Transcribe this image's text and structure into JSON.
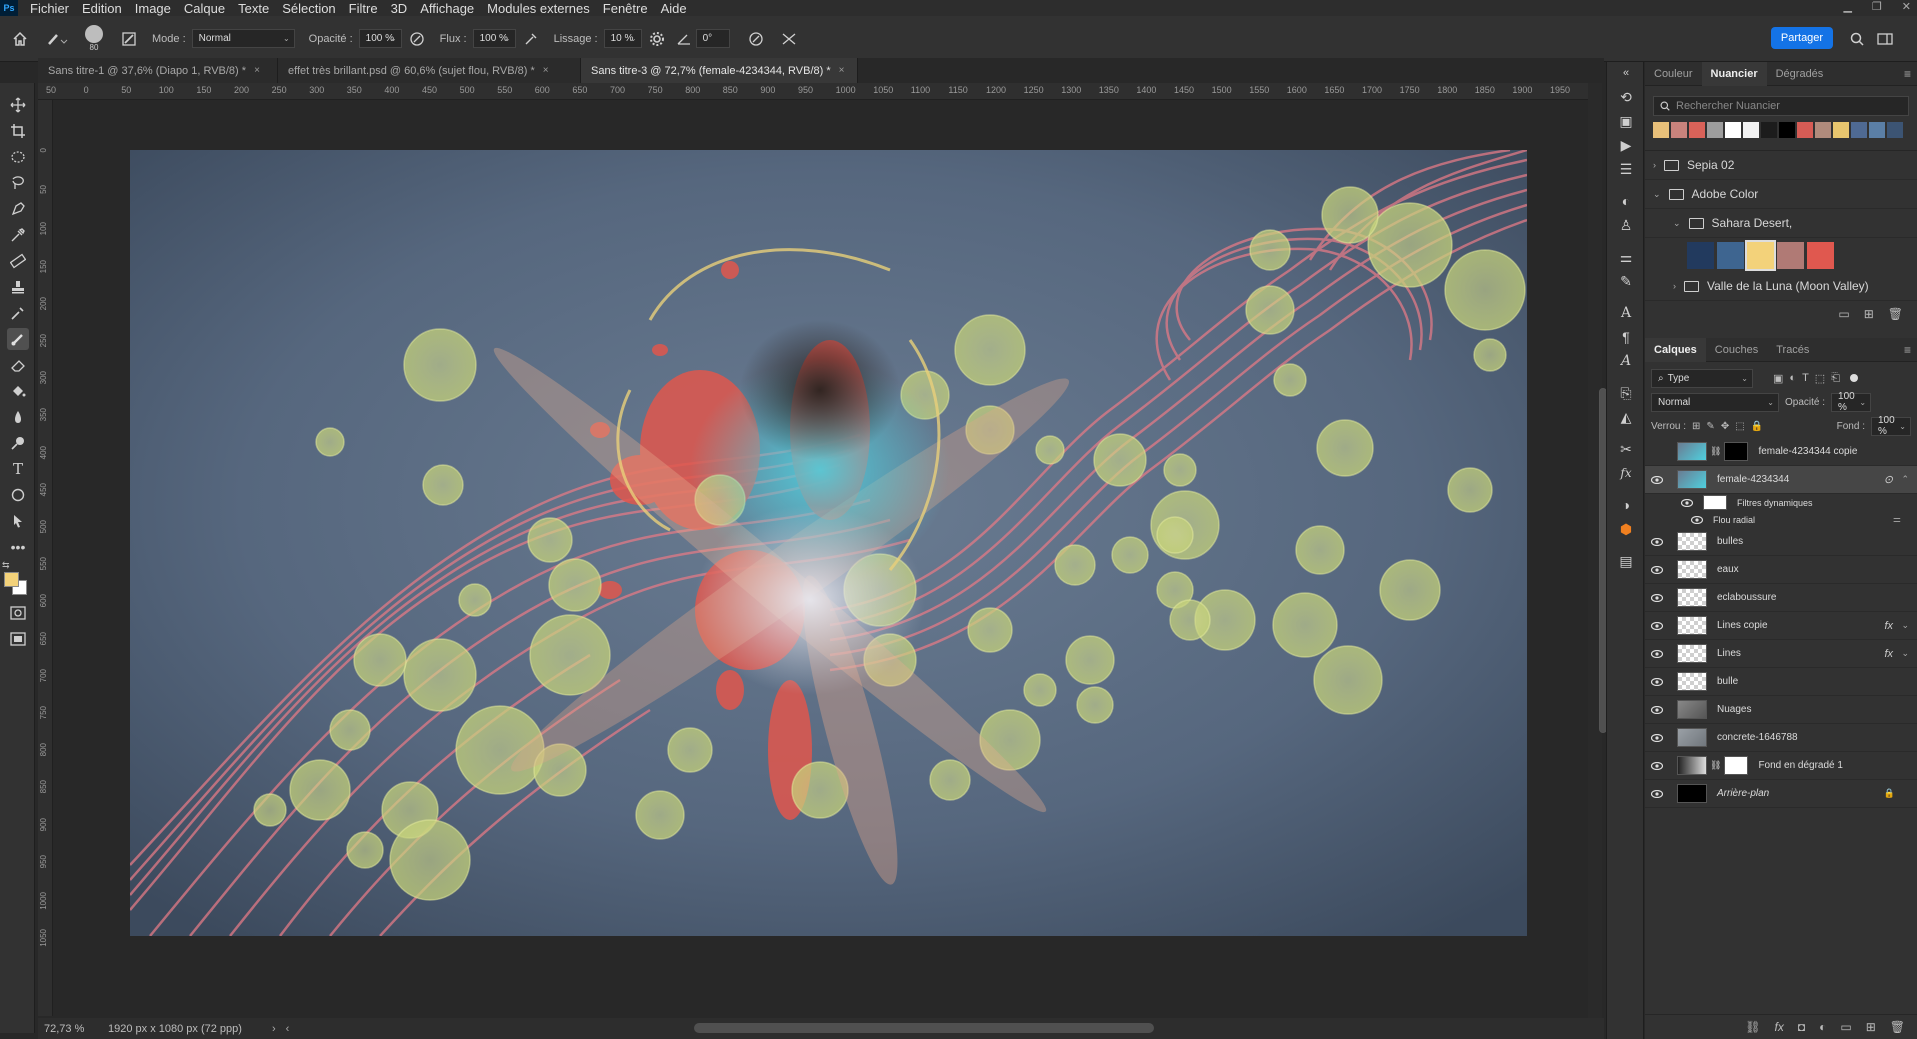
{
  "menu": [
    "Fichier",
    "Edition",
    "Image",
    "Calque",
    "Texte",
    "Sélection",
    "Filtre",
    "3D",
    "Affichage",
    "Modules externes",
    "Fenêtre",
    "Aide"
  ],
  "app_logo": "Ps",
  "options": {
    "brush_size": "80",
    "mode_label": "Mode :",
    "mode_value": "Normal",
    "opacity_label": "Opacité :",
    "opacity_value": "100 %",
    "flow_label": "Flux :",
    "flow_value": "100 %",
    "smoothing_label": "Lissage :",
    "smoothing_value": "10 %",
    "angle_value": "0°",
    "share_label": "Partager"
  },
  "tabs": [
    {
      "label": "Sans titre-1 @ 37,6% (Diapo 1, RVB/8) *",
      "active": false
    },
    {
      "label": "effet très brillant.psd @ 60,6% (sujet flou, RVB/8) *",
      "active": false
    },
    {
      "label": "Sans titre-3 @ 72,7% (female-4234344, RVB/8) *",
      "active": true
    }
  ],
  "ruler_h": [
    "50",
    "0",
    "50",
    "100",
    "150",
    "200",
    "250",
    "300",
    "350",
    "400",
    "450",
    "500",
    "550",
    "600",
    "650",
    "700",
    "750",
    "800",
    "850",
    "900",
    "950",
    "1000",
    "1050",
    "1100",
    "1150",
    "1200",
    "1250",
    "1300",
    "1350",
    "1400",
    "1450",
    "1500",
    "1550",
    "1600",
    "1650",
    "1700",
    "1750",
    "1800",
    "1850",
    "1900",
    "1950"
  ],
  "ruler_v": [
    "0",
    "50",
    "100",
    "150",
    "200",
    "250",
    "300",
    "350",
    "400",
    "450",
    "500",
    "550",
    "600",
    "650",
    "700",
    "750",
    "800",
    "850",
    "900",
    "950",
    "1000",
    "1050"
  ],
  "status": {
    "zoom": "72,73 %",
    "doc_info": "1920 px x 1080 px (72 ppp)"
  },
  "swatches_panel": {
    "tabs": [
      "Couleur",
      "Nuancier",
      "Dégradés"
    ],
    "active_tab": "Nuancier",
    "search_placeholder": "Rechercher Nuancier",
    "recent": [
      "#e8c07a",
      "#c9837c",
      "#d96259",
      "#9d9d9d",
      "#ffffff",
      "#f2f2f2",
      "#1c1c1c",
      "#000000",
      "#d65c55",
      "#b08b7c",
      "#e7c56e",
      "#4f6a93",
      "#5b7fa6",
      "#3c5473"
    ],
    "groups": [
      "Sepia 02",
      "Adobe Color",
      "Sahara Desert,",
      "Valle de la Luna (Moon Valley)"
    ],
    "sahara_swatches": [
      "#223a5e",
      "#3e6590",
      "#f3d27a",
      "#b07a75",
      "#e0584f"
    ]
  },
  "layers_panel": {
    "tabs": [
      "Calques",
      "Couches",
      "Tracés"
    ],
    "active_tab": "Calques",
    "filter_value": "Type",
    "blend_mode": "Normal",
    "opacity_label": "Opacité :",
    "opacity_value": "100 %",
    "lock_label": "Verrou :",
    "fill_label": "Fond :",
    "fill_value": "100 %",
    "layers": [
      {
        "name": "female-4234344 copie",
        "visible": false,
        "italic": false,
        "fx": false
      },
      {
        "name": "female-4234344",
        "visible": true,
        "italic": false,
        "fx": false,
        "active": true
      },
      {
        "name": "Filtres dynamiques",
        "sub": true,
        "visible": true
      },
      {
        "name": "Flou radial",
        "sub2": true,
        "visible": true
      },
      {
        "name": "bulles",
        "visible": true,
        "fx": false
      },
      {
        "name": "eaux",
        "visible": true,
        "fx": false
      },
      {
        "name": "eclaboussure",
        "visible": true,
        "fx": false
      },
      {
        "name": "Lines copie",
        "visible": true,
        "fx": true
      },
      {
        "name": "Lines",
        "visible": true,
        "fx": true
      },
      {
        "name": "bulle",
        "visible": true,
        "fx": false
      },
      {
        "name": "Nuages",
        "visible": true,
        "fx": false
      },
      {
        "name": "concrete-1646788",
        "visible": true,
        "fx": false
      },
      {
        "name": "Fond en dégradé 1",
        "visible": true,
        "fx": false
      },
      {
        "name": "Arrière-plan",
        "visible": true,
        "italic": true,
        "locked": true
      }
    ],
    "fx_label": "fx"
  },
  "colors": {
    "accent": "#1473e6",
    "foreground": "#f3d27a",
    "background": "#ffffff"
  }
}
